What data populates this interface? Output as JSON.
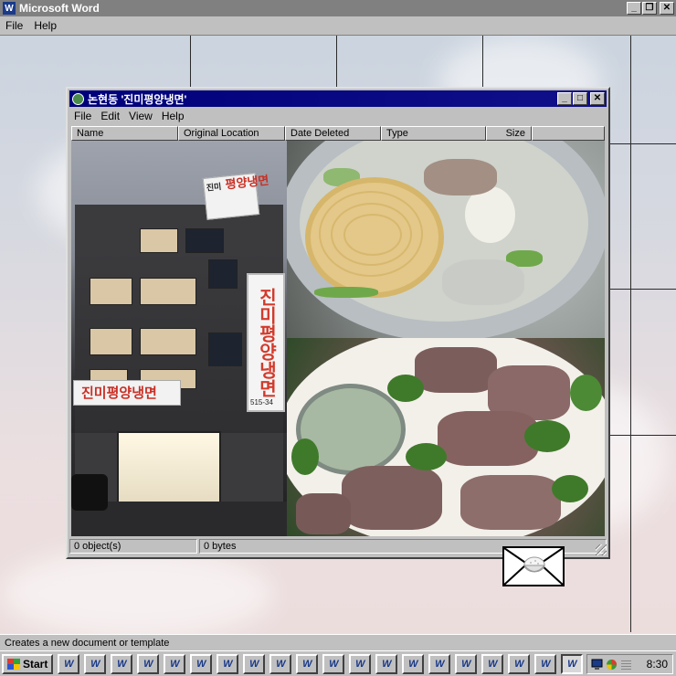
{
  "app": {
    "title": "Microsoft Word",
    "menu": [
      "File",
      "Help"
    ]
  },
  "window": {
    "title": "논현동 '진미평양냉면'",
    "menu": [
      "File",
      "Edit",
      "View",
      "Help"
    ],
    "columns": [
      "Name",
      "Original Location",
      "Date Deleted",
      "Type",
      "Size"
    ],
    "status": {
      "objects": "0 object(s)",
      "bytes": "0 bytes"
    }
  },
  "photos": {
    "building_signs": {
      "top_sign_small": "진미",
      "top_sign_large": "평양냉면",
      "vertical_sign": "진미평양냉면",
      "vertical_sign_number": "515-34",
      "front_sign": "진미평양냉면"
    }
  },
  "statusbar": {
    "text": "Creates a new document or template"
  },
  "taskbar": {
    "start_label": "Start",
    "clock": "8:30",
    "task_button_count": 20
  },
  "icons": {
    "envelope": "envelope-icon",
    "rice_bowl": "rice-bowl-icon"
  }
}
